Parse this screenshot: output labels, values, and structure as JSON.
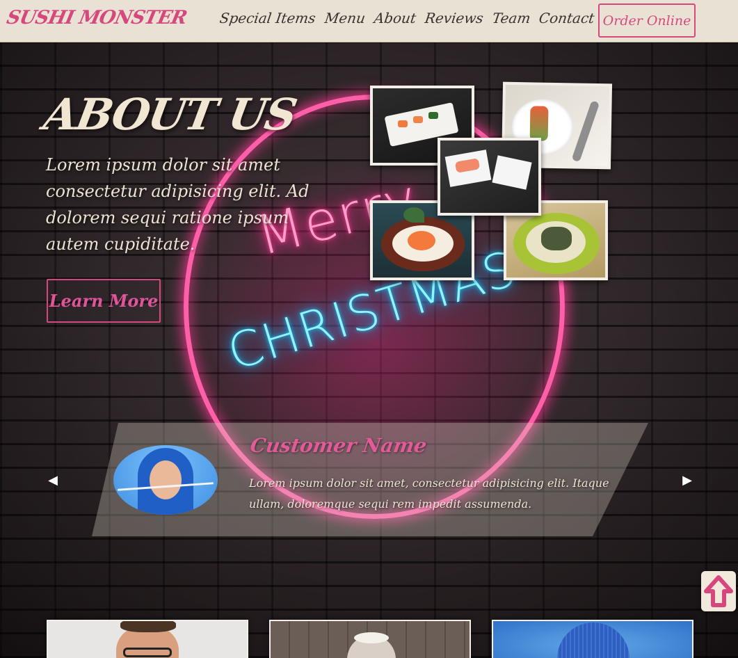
{
  "navbar": {
    "brand": "SUSHI MONSTER",
    "links": [
      "Special Items",
      "Menu",
      "About",
      "Reviews",
      "Team",
      "Contact"
    ],
    "order_button": "Order Online",
    "text_color": "#3a3030",
    "accent_color": "#d6487d",
    "background": "#e9e2d4"
  },
  "hero": {
    "neon_sign": {
      "line1": "Merry",
      "line2": "CHRISTMAS"
    },
    "pink_glow": "#ff3b96",
    "blue_glow": "#10c8ff"
  },
  "about": {
    "title": "ABOUT US",
    "text": "Lorem ipsum dolor sit amet consectetur adipisicing elit. Ad dolorem sequi ratione ipsum autem cupiditate.",
    "button": "Learn More",
    "gallery": [
      {
        "icon": "sushi-plate-photo"
      },
      {
        "icon": "sushi-roll-photo"
      },
      {
        "icon": "sashimi-set-photo"
      },
      {
        "icon": "salmon-bowl-photo"
      },
      {
        "icon": "onigiri-bowl-photo"
      }
    ]
  },
  "testimonial": {
    "name": "Customer Name",
    "quote": "Lorem ipsum dolor sit amet, consectetur adipisicing elit. Itaque ullam, doloremque sequi rem impedit assumenda.",
    "prev_icon": "chevron-left-icon",
    "next_icon": "chevron-right-icon",
    "prev_glyph": "◀",
    "next_glyph": "▶"
  },
  "scroll_top": {
    "icon": "arrow-up-icon",
    "color": "#d6487d"
  },
  "team": [
    {
      "photo": "team-member-glasses-photo"
    },
    {
      "photo": "team-member-bald-photo"
    },
    {
      "photo": "team-member-bluecap-photo"
    }
  ]
}
